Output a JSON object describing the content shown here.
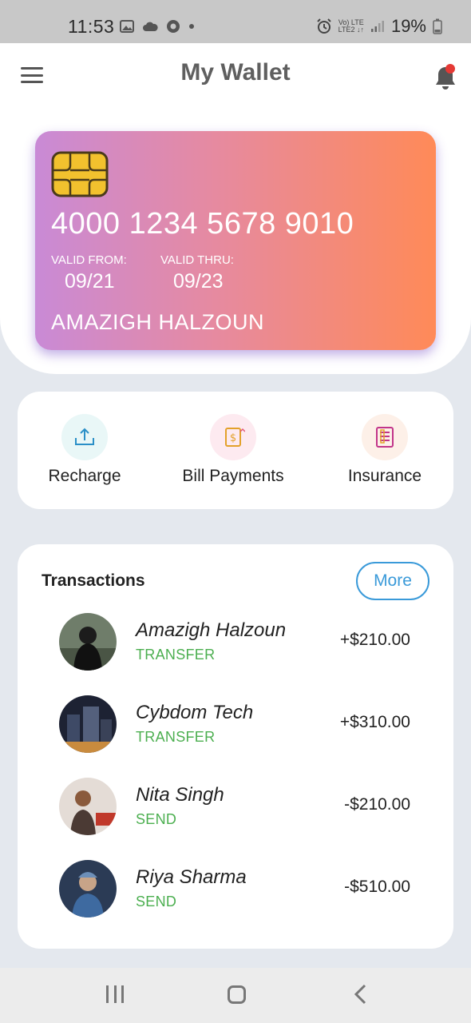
{
  "status_bar": {
    "time": "11:53",
    "network_top": "Vo) LTE",
    "network_bottom": "LTE2 ↓↑",
    "battery": "19%"
  },
  "header": {
    "title": "My Wallet"
  },
  "card": {
    "number": "4000 1234 5678 9010",
    "valid_from_label": "VALID FROM:",
    "valid_from": "09/21",
    "valid_thru_label": "VALID THRU:",
    "valid_thru": "09/23",
    "holder": "AMAZIGH HALZOUN",
    "gradient": [
      "#c98ad6",
      "#ff8a58"
    ]
  },
  "actions": [
    {
      "label": "Recharge",
      "icon": "upload-icon",
      "bg": "#e9f7f7",
      "color": "#2a8fc7"
    },
    {
      "label": "Bill Payments",
      "icon": "bill-icon",
      "bg": "#fdeaf0",
      "color": "#e3a12a"
    },
    {
      "label": "Insurance",
      "icon": "insurance-icon",
      "bg": "#fdf0e8",
      "color": "#c2358a"
    }
  ],
  "transactions": {
    "title": "Transactions",
    "more_label": "More",
    "items": [
      {
        "name": "Amazigh Halzoun",
        "type": "TRANSFER",
        "amount": "+$210.00"
      },
      {
        "name": "Cybdom Tech",
        "type": "TRANSFER",
        "amount": "+$310.00"
      },
      {
        "name": "Nita Singh",
        "type": "SEND",
        "amount": "-$210.00"
      },
      {
        "name": "Riya Sharma",
        "type": "SEND",
        "amount": "-$510.00"
      }
    ]
  },
  "colors": {
    "accent": "#3a9ad9",
    "positive_type": "#4caf50",
    "notification_dot": "#e53935"
  }
}
